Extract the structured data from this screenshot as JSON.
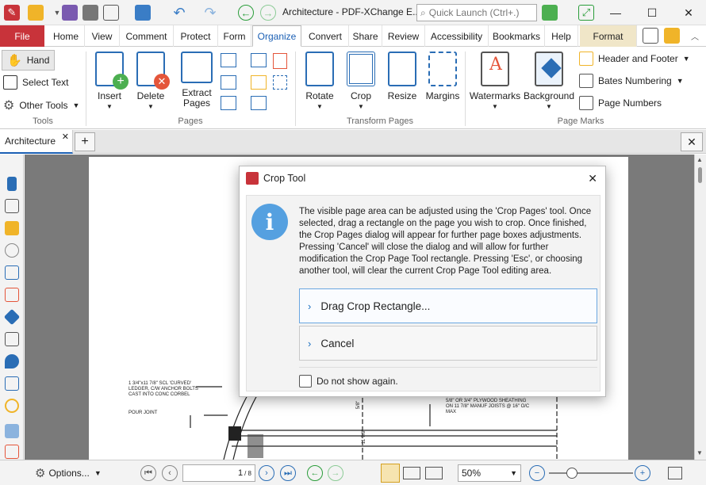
{
  "window": {
    "title": "Architecture - PDF-XChange E...",
    "quick_launch_placeholder": "Quick Launch (Ctrl+.)"
  },
  "ribbon_tabs": [
    "File",
    "Home",
    "View",
    "Comment",
    "Protect",
    "Form",
    "Organize",
    "Convert",
    "Share",
    "Review",
    "Accessibility",
    "Bookmarks",
    "Help",
    "Format"
  ],
  "active_tab": "Organize",
  "ribbon": {
    "tools": {
      "label": "Tools",
      "hand": "Hand",
      "select_text": "Select Text",
      "other_tools": "Other Tools"
    },
    "pages": {
      "label": "Pages",
      "insert": "Insert",
      "delete": "Delete",
      "extract": "Extract Pages"
    },
    "transform": {
      "label": "Transform Pages",
      "rotate": "Rotate",
      "crop": "Crop",
      "resize": "Resize",
      "margins": "Margins"
    },
    "marks": {
      "label": "Page Marks",
      "watermarks": "Watermarks",
      "background": "Background",
      "header_footer": "Header and Footer",
      "bates": "Bates Numbering",
      "page_numbers": "Page Numbers"
    }
  },
  "doc_tab": {
    "name": "Architecture"
  },
  "drawing_notes": {
    "note1": "1 3/4\"x11 7/8\" SCL 'CURVED' LEDGER, C/W ANCHOR BOLTS CAST INTO CONC CORBEL",
    "note2": "POUR JOINT",
    "note3": "5/8\" OR 3/4\" PLYWOOD SHEATHING ON 11 7/8\" MANUF JOISTS @ 16\" O/C MAX",
    "dim1": "5/8\"",
    "dim2": "11 7/8\""
  },
  "dialog": {
    "title": "Crop Tool",
    "message": "The visible page area can be adjusted using the 'Crop Pages' tool. Once selected, drag a rectangle on the page you wish to crop. Once finished, the Crop Pages dialog will appear for further page boxes adjustments. Pressing 'Cancel' will close the dialog and will allow for further modification the Crop Page Tool rectangle. Pressing 'Esc', or choosing another tool, will clear the current Crop Page Tool editing area.",
    "option_drag": "Drag Crop Rectangle...",
    "option_cancel": "Cancel",
    "checkbox": "Do not show again."
  },
  "statusbar": {
    "options": "Options...",
    "page_current": "1",
    "page_total": "/ 8",
    "zoom": "50%"
  }
}
